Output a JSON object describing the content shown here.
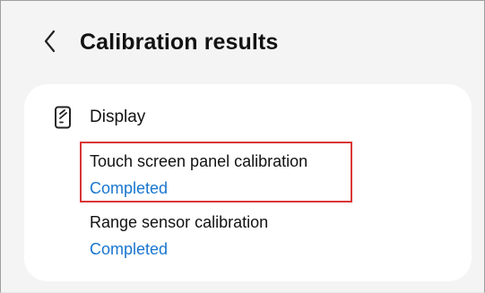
{
  "header": {
    "back_icon": "chevron-left-icon",
    "title": "Calibration results"
  },
  "section": {
    "icon": "phone-display-icon",
    "title": "Display"
  },
  "items": [
    {
      "title": "Touch screen panel calibration",
      "status": "Completed",
      "highlighted": true
    },
    {
      "title": "Range sensor calibration",
      "status": "Completed",
      "highlighted": false
    }
  ],
  "colors": {
    "background": "#f4f4f4",
    "card": "#ffffff",
    "status": "#1976cf",
    "highlight": "#d93636"
  }
}
